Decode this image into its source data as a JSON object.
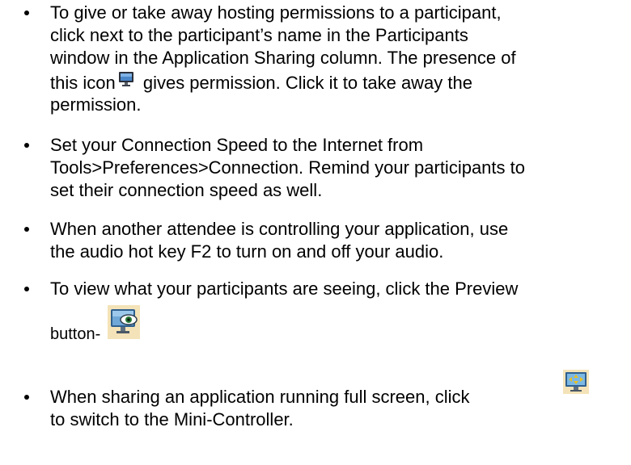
{
  "bullets": [
    {
      "lines": [
        "To give or take away hosting permissions to a participant,",
        "click next to the participant’s name in the Participants",
        "window in the Application Sharing column. The presence of",
        [
          "this icon",
          " gives permission. Click it to take away the"
        ],
        "permission."
      ]
    },
    {
      "lines": [
        "Set your Connection Speed to the Internet from",
        "Tools>Preferences>Connection. Remind your participants to",
        "set their connection speed as well."
      ]
    },
    {
      "lines": [
        "When another attendee is controlling your application, use",
        "the audio hot key F2 to turn on and off your audio."
      ]
    },
    {
      "lines": [
        "To view what your participants are seeing, click the Preview",
        "button-"
      ]
    },
    {
      "lines": [
        "When sharing an application running full screen, click",
        "to switch to the Mini-Controller."
      ]
    }
  ],
  "icons": {
    "permission": "monitor-icon",
    "preview": "preview-icon",
    "mini_controller": "mini-controller-icon"
  },
  "colors": {
    "text": "#000000",
    "icon_bg": "#f4e3b8"
  }
}
